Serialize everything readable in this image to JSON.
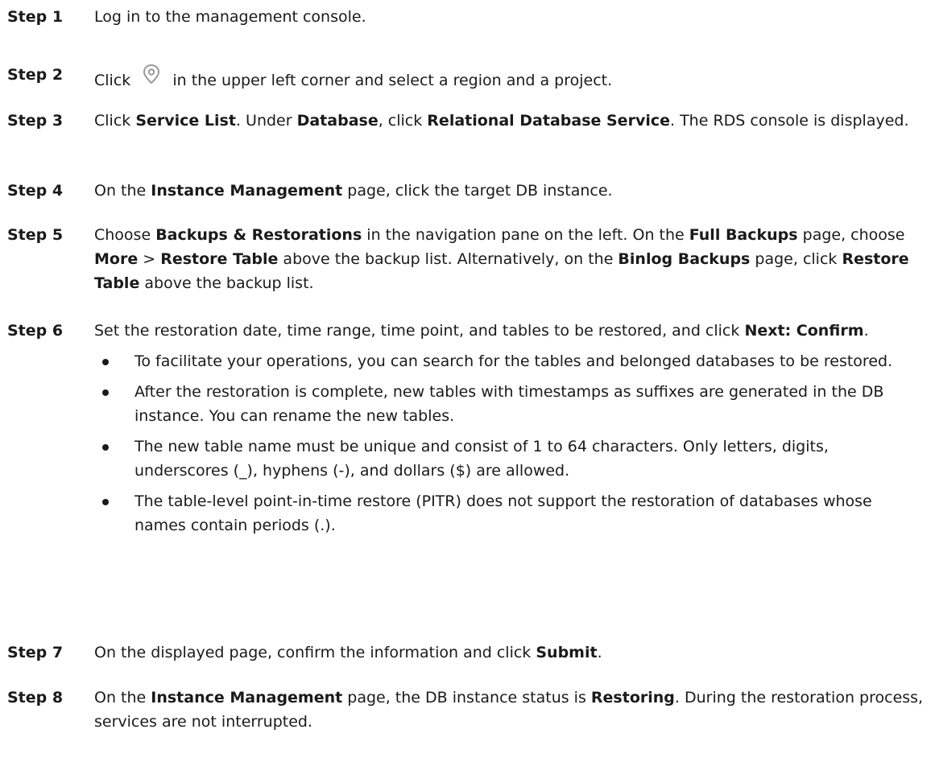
{
  "steps": [
    {
      "label": "Step 1",
      "text": "Log in to the management console."
    },
    {
      "label": "Step 2",
      "pre": "Click",
      "post": "in the upper left corner and select a region and a project.",
      "icon": "location-pin-icon"
    },
    {
      "label": "Step 3",
      "parts": [
        "Click ",
        "Service List",
        ". Under ",
        "Database",
        ", click ",
        "Relational Database Service",
        ". The RDS console is displayed."
      ]
    },
    {
      "label": "Step 4",
      "parts": [
        "On the ",
        "Instance Management",
        " page, click the target DB instance."
      ]
    },
    {
      "label": "Step 5",
      "parts": [
        "Choose ",
        "Backups & Restorations",
        " in the navigation pane on the left. On the ",
        "Full Backups",
        " page, choose ",
        "More",
        " > ",
        "Restore Table",
        " above the backup list. Alternatively, on the ",
        "Binlog Backups",
        " page, click ",
        "Restore Table",
        " above the backup list."
      ]
    },
    {
      "label": "Step 6",
      "parts": [
        "Set the restoration date, time range, time point, and tables to be restored, and click ",
        "Next: Confirm",
        "."
      ],
      "bullets": [
        "To facilitate your operations, you can search for the tables and belonged databases to be restored.",
        "After the restoration is complete, new tables with timestamps as suffixes are generated in the DB instance. You can rename the new tables.",
        "The new table name must be unique and consist of 1 to 64 characters. Only letters, digits, underscores (_), hyphens (-), and dollars ($) are allowed.",
        "The table-level point-in-time restore (PITR) does not support the restoration of databases whose names contain periods (.)."
      ]
    },
    {
      "label": "Step 7",
      "parts": [
        "On the displayed page, confirm the information and click ",
        "Submit",
        "."
      ]
    },
    {
      "label": "Step 8",
      "parts": [
        "On the ",
        "Instance Management",
        " page, the DB instance status is ",
        "Restoring",
        ". During the restoration process, services are not interrupted."
      ]
    }
  ]
}
